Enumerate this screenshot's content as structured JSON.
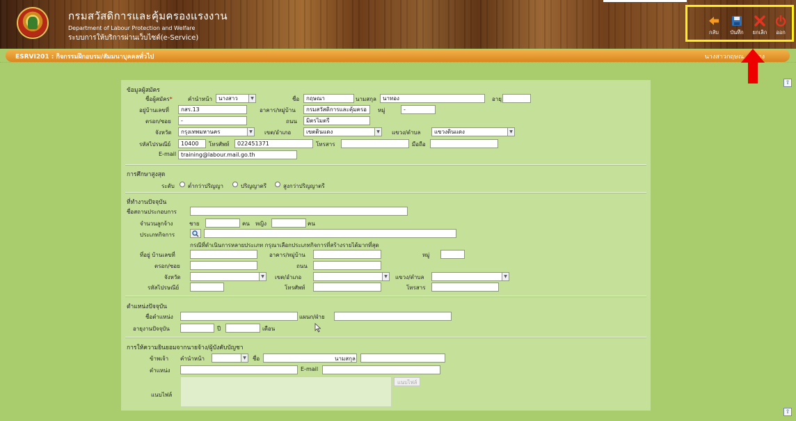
{
  "header": {
    "brand_th": "กรมสวัสดิการและคุ้มครองแรงงาน",
    "brand_en": "Department of Labour Protection and Welfare",
    "brand_sub": "ระบบการให้บริการผ่านเว็บไซต์(e-Service)"
  },
  "toolbar": {
    "back_label": "กลับ",
    "save_label": "บันทึก",
    "cancel_label": "ยกเลิก",
    "exit_label": "ออก",
    "highlight_color": "#ffef1a"
  },
  "titlebar": {
    "title": "ESRVI201 : กิจกรรมฝึกอบรม/สัมมนาบุคคลทั่วไป",
    "user": "นางสาวกฤษณ... ...อง"
  },
  "sections": {
    "applicant": "ข้อมูลผู้สมัคร",
    "education": "การศึกษาสูงสุด",
    "workplace": "ที่ทำงานปัจจุบัน",
    "position": "ตำแหน่งปัจจุบัน",
    "consent": "การให้ความยินยอมจากนายจ้าง/ผู้บังคับบัญชา"
  },
  "applicant": {
    "name_label": "ชื่อผู้สมัคร",
    "required_mark": "*",
    "prefix_label": "คำนำหน้า",
    "prefix_value": "นางสาว",
    "first_label": "ชื่อ",
    "first_value": "กฤษณา",
    "last_label": "นามสกุล",
    "last_value": "นาทอง",
    "age_label": "อายุ",
    "age_value": "",
    "houseno_label": "อยู่บ้านเลขที่",
    "houseno_value": "กสร.13",
    "building_label": "อาคาร/หมู่บ้าน",
    "building_value": "กรมสวัสดิการและคุ้มครอ",
    "moo_label": "หมู่",
    "moo_value": "-",
    "soi_label": "ตรอก/ซอย",
    "soi_value": "-",
    "road_label": "ถนน",
    "road_value": "มิตรไมตรี",
    "province_label": "จังหวัด",
    "province_value": "กรุงเทพมหานคร",
    "district_label": "เขต/อำเภอ",
    "district_value": "เขตดินแดง",
    "subdistrict_label": "แขวง/ตำบล",
    "subdistrict_value": "แขวงดินแดง",
    "zip_label": "รหัสไปรษณีย์",
    "zip_value": "10400",
    "phone_label": "โทรศัพท์",
    "phone_value": "022451371",
    "fax_label": "โทรสาร",
    "fax_value": "",
    "mobile_label": "มือถือ",
    "mobile_value": "",
    "email_label": "E-mail",
    "email_value": "training@labour.mail.go.th"
  },
  "education": {
    "level_label": "ระดับ",
    "options": [
      "ต่ำกว่าปริญญา",
      "ปริญญาตรี",
      "สูงกว่าปริญญาตรี"
    ]
  },
  "workplace": {
    "company_label": "ชื่อสถานประกอบการ",
    "employees_label": "จำนวนลูกจ้าง",
    "male_label": "ชาย",
    "person_unit": "คน",
    "female_label": "หญิง",
    "business_type_label": "ประเภทกิจการ",
    "note": "กรณีที่ดำเนินการหลายประเภท กรุณาเลือกประเภทกิจการที่สร้างรายได้มากที่สุด",
    "houseno_label": "ที่อยู่ บ้านเลขที่",
    "building_label": "อาคาร/หมู่บ้าน",
    "moo_label": "หมู่",
    "soi_label": "ตรอก/ซอย",
    "road_label": "ถนน",
    "province_label": "จังหวัด",
    "district_label": "เขต/อำเภอ",
    "subdistrict_label": "แขวง/ตำบล",
    "zip_label": "รหัสไปรษณีย์",
    "phone_label": "โทรศัพท์",
    "fax_label": "โทรสาร"
  },
  "position": {
    "title_label": "ชื่อตำแหน่ง",
    "dept_label": "แผนก/ฝ่าย",
    "tenure_label": "อายุงานปัจจุบัน",
    "year_label": "ปี",
    "month_label": "เดือน"
  },
  "consent": {
    "me_label": "ข้าพเจ้า",
    "prefix_label": "คำนำหน้า",
    "name_label": "ชื่อ",
    "last_label": "นามสกุล",
    "position_label": "ตำแหน่ง",
    "email_label": "E-mail",
    "attach_label": "แนบไฟล์",
    "attach_button": "แนบไฟล์"
  }
}
